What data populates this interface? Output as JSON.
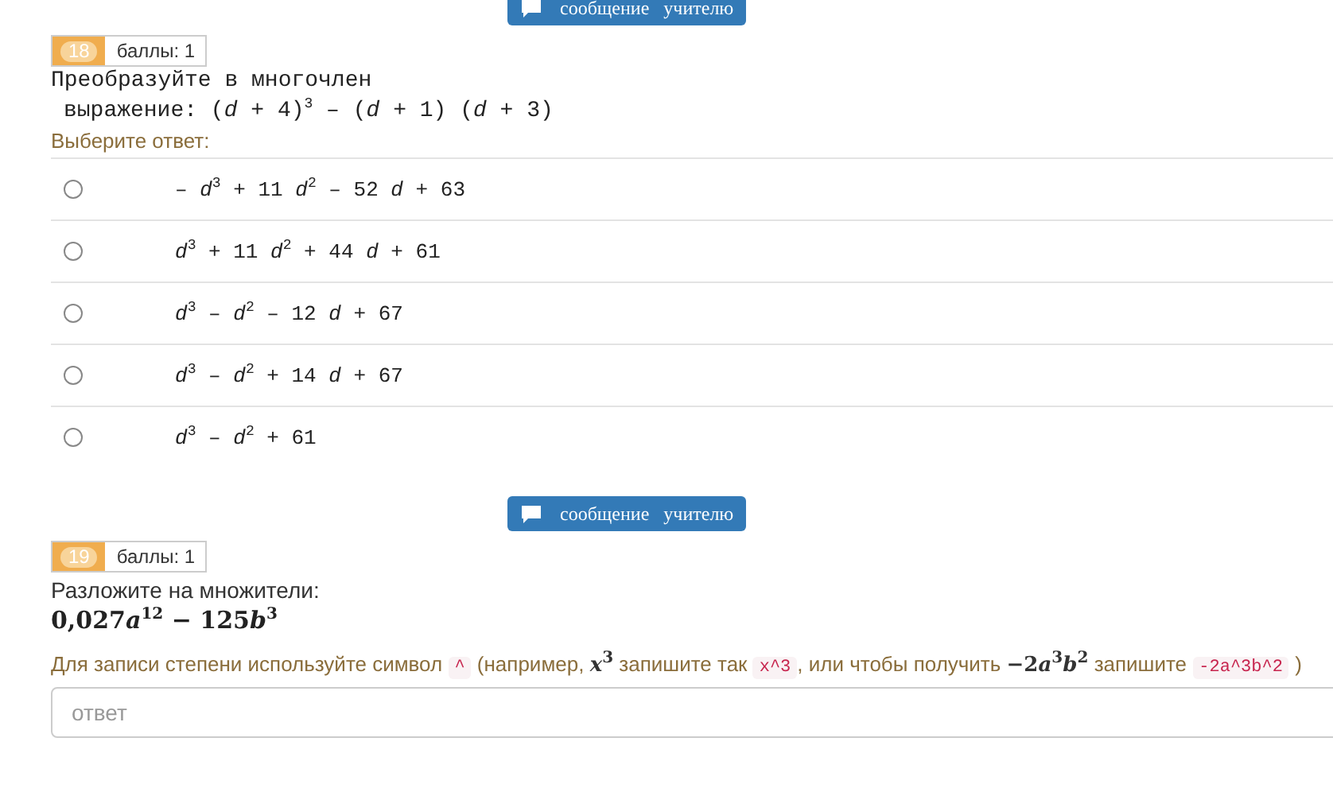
{
  "questions": [
    {
      "message_button": "сообщение   учителю",
      "number": "18",
      "points": "баллы: 1",
      "prompt": "Преобразуйте в многочлен",
      "expression": "выражение: (*d* + 4)$^{3}$ – (*d* + 1) (*d* + 3)",
      "choose_label": "Выберите ответ:",
      "options": [
        {
          "text": "– *d*$^{3}$ + 11 *d*$^{2}$ – 52 *d* + 63",
          "selected": false
        },
        {
          "text": "*d*$^{3}$ + 11 *d*$^{2}$ + 44 *d* + 61",
          "selected": false
        },
        {
          "text": "*d*$^{3}$ – *d*$^{2}$ – 12 *d* + 67",
          "selected": false
        },
        {
          "text": "*d*$^{3}$ – *d*$^{2}$ + 14 *d* + 67",
          "selected": false
        },
        {
          "text": "*d*$^{3}$ – *d*$^{2}$ + 61",
          "selected": false
        }
      ]
    },
    {
      "message_button": "сообщение   учителю",
      "number": "19",
      "points": "баллы: 1",
      "prompt": "Разложите на множители:",
      "formula": [
        {
          "kind": "num",
          "text": "0,027"
        },
        {
          "kind": "var",
          "text": "a"
        },
        {
          "kind": "sup",
          "text": "12"
        },
        {
          "kind": "op",
          "text": " − "
        },
        {
          "kind": "num",
          "text": "125"
        },
        {
          "kind": "var",
          "text": "b"
        },
        {
          "kind": "sup",
          "text": "3"
        }
      ],
      "hint": [
        {
          "kind": "text",
          "text": "Для записи степени используйте символ "
        },
        {
          "kind": "code",
          "text": "^"
        },
        {
          "kind": "text",
          "text": " (например, "
        },
        {
          "kind": "math",
          "parts": [
            {
              "kind": "var",
              "text": "x"
            },
            {
              "kind": "sup",
              "text": "3"
            }
          ]
        },
        {
          "kind": "text",
          "text": " запишите так "
        },
        {
          "kind": "code",
          "text": "x^3"
        },
        {
          "kind": "text",
          "text": ", или чтобы получить "
        },
        {
          "kind": "math",
          "parts": [
            {
              "kind": "num",
              "text": "−2"
            },
            {
              "kind": "var",
              "text": "a"
            },
            {
              "kind": "sup",
              "text": "3"
            },
            {
              "kind": "var",
              "text": "b"
            },
            {
              "kind": "sup",
              "text": "2"
            }
          ]
        },
        {
          "kind": "text",
          "text": " запишите "
        },
        {
          "kind": "code",
          "text": "-2a^3b^2"
        },
        {
          "kind": "text",
          "text": " )"
        }
      ],
      "answer_placeholder": "ответ"
    }
  ]
}
